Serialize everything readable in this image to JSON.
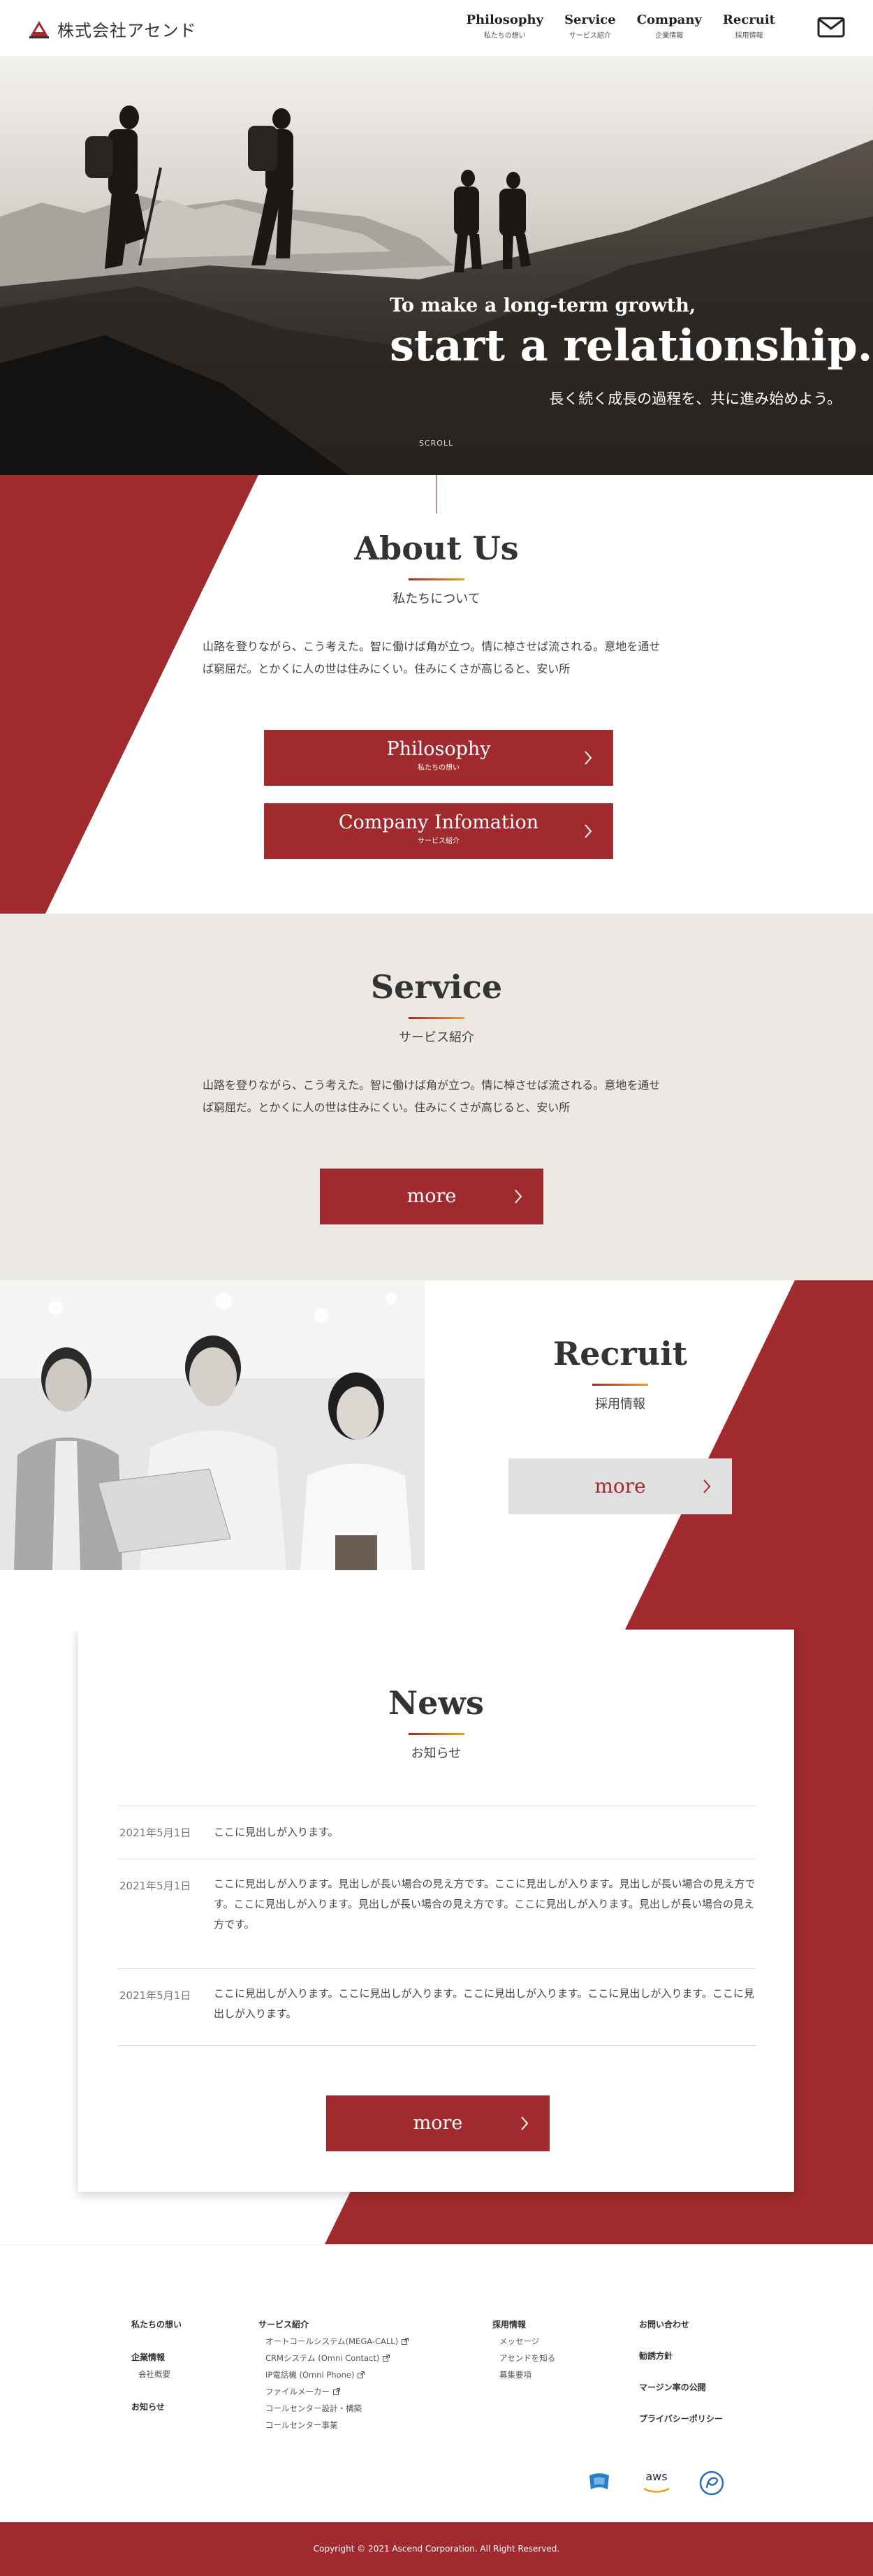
{
  "header": {
    "logo_text": "株式会社アセンド",
    "nav": [
      {
        "en": "Philosophy",
        "jp": "私たちの想い"
      },
      {
        "en": "Service",
        "jp": "サービス紹介"
      },
      {
        "en": "Company",
        "jp": "企業情報"
      },
      {
        "en": "Recruit",
        "jp": "採用情報"
      }
    ],
    "mail_icon": "mail-icon"
  },
  "hero": {
    "sub": "To make a long-term growth,",
    "main": "start a relationship.",
    "jp": "長く続く成長の過程を、共に進み始めよう。",
    "scroll": "SCROLL"
  },
  "about": {
    "title": "About Us",
    "subtitle": "私たちについて",
    "text": "山路を登りながら、こう考えた。智に働けば角が立つ。情に棹させば流される。意地を通せば窮屈だ。とかくに人の世は住みにくい。住みにくさが高じると、安い所",
    "buttons": [
      {
        "en": "Philosophy",
        "jp": "私たちの想い"
      },
      {
        "en": "Company Infomation",
        "jp": "サービス紹介"
      }
    ]
  },
  "service": {
    "title": "Service",
    "subtitle": "サービス紹介",
    "text": "山路を登りながら、こう考えた。智に働けば角が立つ。情に棹させば流される。意地を通せば窮屈だ。とかくに人の世は住みにくい。住みにくさが高じると、安い所",
    "more": "more"
  },
  "recruit": {
    "title": "Recruit",
    "subtitle": "採用情報",
    "more": "more"
  },
  "news": {
    "title": "News",
    "subtitle": "お知らせ",
    "items": [
      {
        "date": "2021年5月1日",
        "text": "ここに見出しが入ります。"
      },
      {
        "date": "2021年5月1日",
        "text": "ここに見出しが入ります。見出しが長い場合の見え方です。ここに見出しが入ります。見出しが長い場合の見え方です。ここに見出しが入ります。見出しが長い場合の見え方です。ここに見出しが入ります。見出しが長い場合の見え方です。"
      },
      {
        "date": "2021年5月1日",
        "text": "ここに見出しが入ります。ここに見出しが入ります。ここに見出しが入ります。ここに見出しが入ります。ここに見出しが入ります。"
      }
    ],
    "more": "more"
  },
  "footer": {
    "col1": {
      "h1": "私たちの想い",
      "h2": "企業情報",
      "l1": "会社概要",
      "h3": "お知らせ"
    },
    "col2": {
      "h": "サービス紹介",
      "links": [
        "オートコールシステム(MEGA-CALL)",
        "CRMシステム (Omni Contact)",
        "IP電話機 (Omni Phone)",
        "ファイルメーカー",
        "コールセンター設計・構築",
        "コールセンター事業"
      ]
    },
    "col3": {
      "h": "採用情報",
      "links": [
        "メッセージ",
        "アセンドを知る",
        "募集要項"
      ]
    },
    "col4": {
      "items": [
        "お問い合わせ",
        "勧誘方針",
        "マージン率の公開",
        "プライバシーポリシー"
      ]
    },
    "partners": [
      "filemaker-logo",
      "aws-logo",
      "privacy-mark-logo"
    ],
    "aws_text": "aws",
    "copyright": "Copyright © 2021  Ascend Corporation. All Right Reserved."
  },
  "colors": {
    "accent": "#a02a2e",
    "beige": "#ece8e3",
    "line_gradient_end": "#f0a020"
  }
}
